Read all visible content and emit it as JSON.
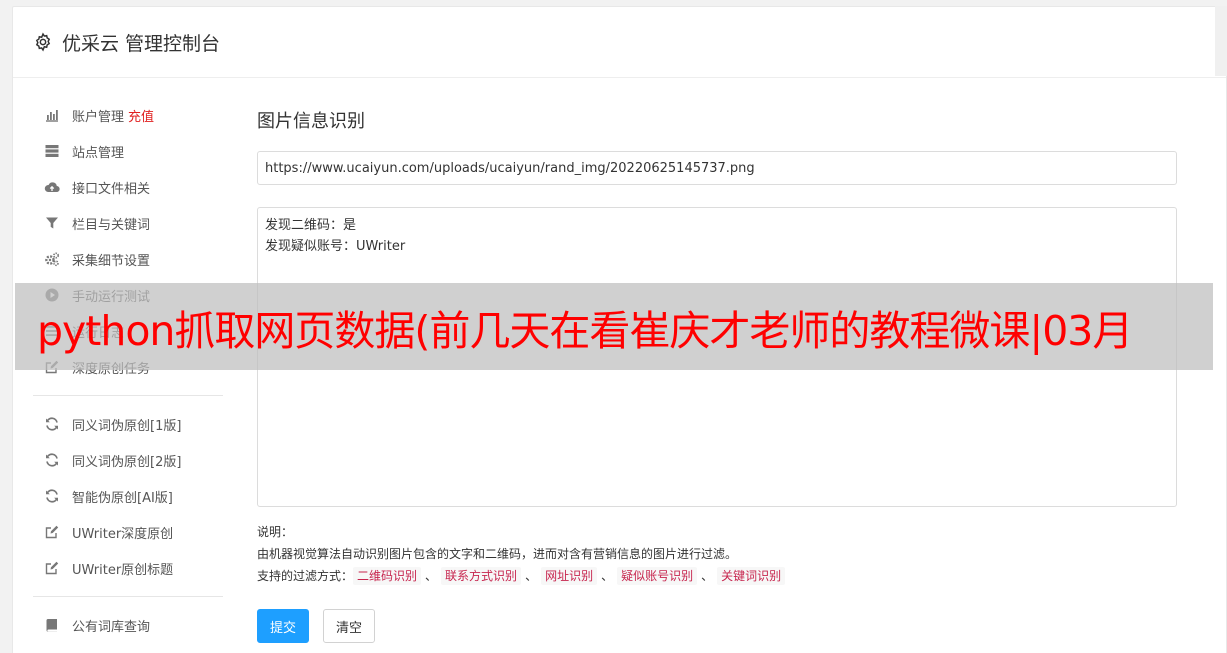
{
  "header": {
    "title": "优采云 管理控制台",
    "icon": "gear-icon"
  },
  "sidebar": {
    "groups": [
      [
        {
          "label": "账户管理",
          "extra": "充值",
          "icon": "bar-chart-icon"
        },
        {
          "label": "站点管理",
          "icon": "server-icon"
        },
        {
          "label": "接口文件相关",
          "icon": "cloud-upload-icon"
        },
        {
          "label": "栏目与关键词",
          "icon": "filter-icon"
        },
        {
          "label": "采集细节设置",
          "icon": "gears-icon"
        },
        {
          "label": "手动运行测试",
          "icon": "play-circle-icon"
        },
        {
          "label": "运行日志",
          "icon": "list-icon"
        },
        {
          "label": "深度原创任务",
          "icon": "edit-icon"
        }
      ],
      [
        {
          "label": "同义词伪原创[1版]",
          "icon": "refresh-icon"
        },
        {
          "label": "同义词伪原创[2版]",
          "icon": "refresh-icon"
        },
        {
          "label": "智能伪原创[AI版]",
          "icon": "refresh-icon"
        },
        {
          "label": "UWriter深度原创",
          "icon": "edit-icon"
        },
        {
          "label": "UWriter原创标题",
          "icon": "edit-icon"
        }
      ],
      [
        {
          "label": "公有词库查询",
          "icon": "book-icon"
        }
      ]
    ]
  },
  "main": {
    "title": "图片信息识别",
    "url_value": "https://www.ucaiyun.com/uploads/ucaiyun/rand_img/20220625145737.png",
    "result_lines": [
      "发现二维码：是",
      "发现疑似账号：UWriter"
    ],
    "desc_label": "说明：",
    "desc_text": "由机器视觉算法自动识别图片包含的文字和二维码，进而对含有营销信息的图片进行过滤。",
    "filter_label": "支持的过滤方式：",
    "filters": [
      "二维码识别",
      "联系方式识别",
      "网址识别",
      "疑似账号识别",
      "关键词识别"
    ],
    "separator": "、",
    "submit_label": "提交",
    "clear_label": "清空"
  },
  "banner": {
    "text": "python抓取网页数据(前几天在看崔庆才老师的教程微课|03月"
  },
  "colors": {
    "accent": "#1e9fff",
    "alert": "#e02020",
    "tag_text": "#c7254e",
    "banner_text": "#ff0000"
  }
}
